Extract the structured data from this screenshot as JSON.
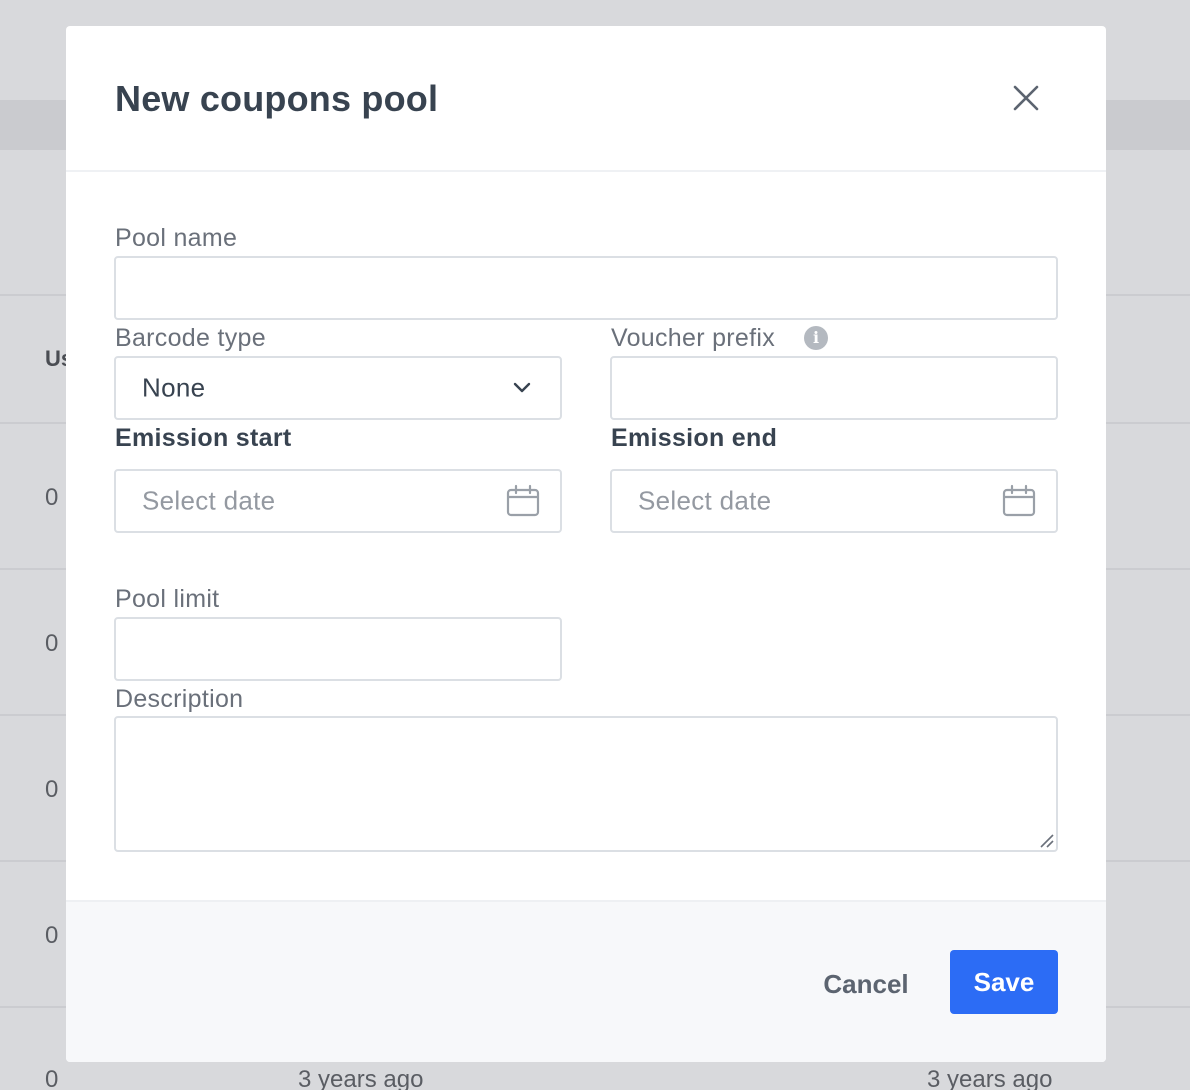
{
  "background": {
    "column_header": "Us",
    "row_values": [
      "0",
      "0",
      "0",
      "0",
      "0"
    ],
    "row_dates": [
      "3 years ago",
      "3 years ago"
    ]
  },
  "modal": {
    "title": "New coupons pool",
    "close_icon": "close-icon",
    "fields": {
      "pool_name": {
        "label": "Pool name",
        "value": ""
      },
      "barcode_type": {
        "label": "Barcode type",
        "value": "None",
        "icon": "chevron-down-icon"
      },
      "voucher_prefix": {
        "label": "Voucher prefix",
        "value": "",
        "info_icon": "info-icon",
        "info_glyph": "i"
      },
      "emission_start": {
        "label": "Emission start",
        "placeholder": "Select date",
        "icon": "calendar-icon"
      },
      "emission_end": {
        "label": "Emission end",
        "placeholder": "Select date",
        "icon": "calendar-icon"
      },
      "pool_limit": {
        "label": "Pool limit",
        "value": ""
      },
      "description": {
        "label": "Description",
        "value": ""
      }
    },
    "footer": {
      "cancel_label": "Cancel",
      "save_label": "Save"
    }
  },
  "colors": {
    "primary": "#2c6cf5",
    "title": "#384350",
    "label": "#6a707a",
    "border": "#dbdfe4",
    "overlay": "#d8d9dc"
  }
}
